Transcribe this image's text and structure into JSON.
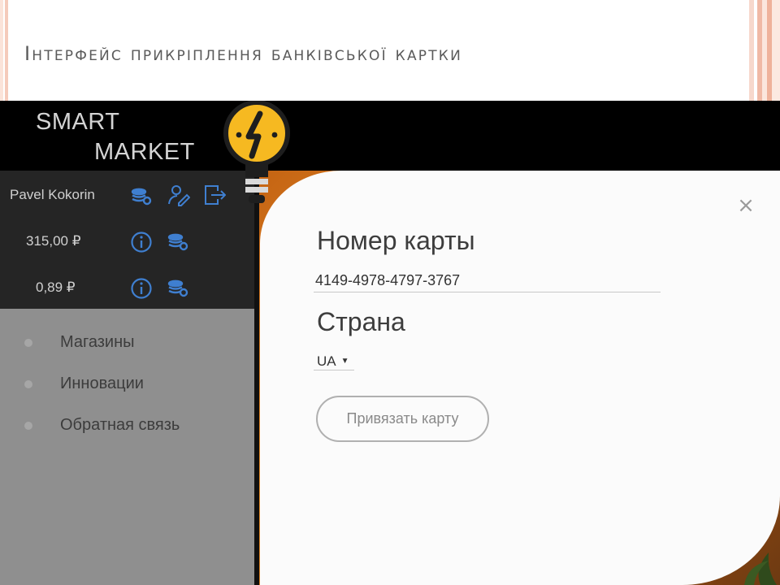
{
  "slide": {
    "title": "Інтерфейс прикріплення банківської картки"
  },
  "app": {
    "logo": {
      "line1": "SMART",
      "line2": "MARKET"
    },
    "user": {
      "name": "Pavel Kokorin"
    },
    "balances": [
      {
        "amount": "315,00 ₽"
      },
      {
        "amount": "0,89 ₽"
      }
    ],
    "nav": {
      "items": [
        {
          "label": "Магазины"
        },
        {
          "label": "Инновации"
        },
        {
          "label": "Обратная связь"
        }
      ]
    },
    "icons": [
      "coins-icon",
      "user-edit-icon",
      "logout-icon",
      "info-icon",
      "lightbulb-logo-icon",
      "close-icon"
    ],
    "colors": {
      "accent_blue": "#3f7fd0",
      "bulb_yellow": "#f6b921",
      "topbar": "#000000",
      "nav_bg": "#8f8f8f"
    }
  },
  "modal": {
    "close_symbol": "×",
    "card_label": "Номер карты",
    "card_number": "4149-4978-4797-3767",
    "country_label": "Страна",
    "country_value": "UA",
    "submit_label": "Привязать карту"
  }
}
